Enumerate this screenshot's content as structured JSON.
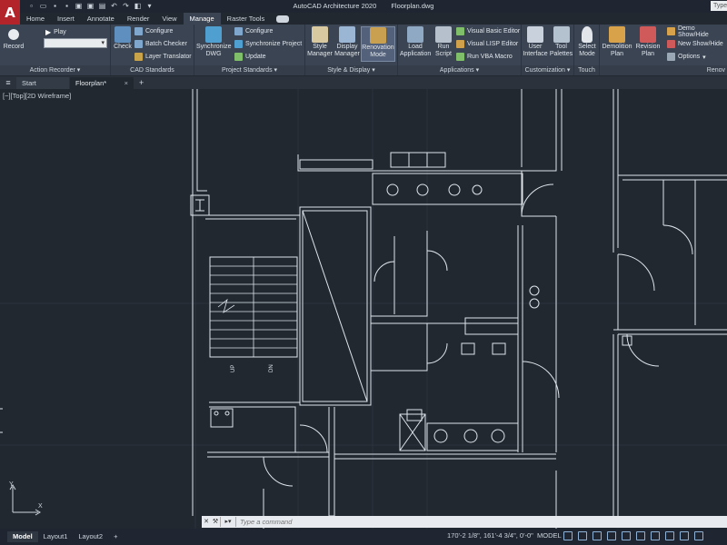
{
  "app": {
    "logo_letter": "A",
    "title": "AutoCAD Architecture 2020",
    "file": "Floorplan.dwg",
    "search_placeholder": "Type"
  },
  "ribbon_tabs": [
    "Home",
    "Insert",
    "Annotate",
    "Render",
    "View",
    "Manage",
    "Raster Tools"
  ],
  "active_tab": "Manage",
  "panels": {
    "action_recorder": {
      "title": "Action Recorder",
      "record": "Record",
      "play": "Play"
    },
    "cad_standards": {
      "title": "CAD Standards",
      "check": "Check",
      "configure": "Configure",
      "batch_checker": "Batch Checker",
      "layer_translator": "Layer Translator"
    },
    "project_standards": {
      "title": "Project Standards",
      "sync_dwg": "Synchronize DWG",
      "configure": "Configure",
      "sync_project": "Synchronize Project",
      "update": "Update"
    },
    "style_display": {
      "title": "Style & Display",
      "style_manager": "Style Manager",
      "display_manager": "Display Manager",
      "renovation_mode": "Renovation Mode"
    },
    "applications": {
      "title": "Applications",
      "load_application": "Load Application",
      "run_script": "Run Script",
      "vb_editor": "Visual Basic Editor",
      "lisp_editor": "Visual LISP Editor",
      "run_vba": "Run VBA Macro"
    },
    "customization": {
      "title": "Customization",
      "user_interface": "User Interface",
      "tool_palettes": "Tool Palettes"
    },
    "touch": {
      "title": "Touch",
      "select_mode": "Select Mode"
    },
    "renovation": {
      "title": "Renov",
      "demolition_plan": "Demolition Plan",
      "revision_plan": "Revision Plan",
      "demo_show_hide": "Demo Show/Hide",
      "new_show_hide": "New Show/Hide",
      "options": "Options"
    }
  },
  "doc_tabs": {
    "start": "Start",
    "floorplan": "Floorplan*",
    "close": "×",
    "new": "+"
  },
  "viewport_label": "[−][Top][2D Wireframe]",
  "ucs": {
    "x": "X",
    "y": "Y"
  },
  "command": {
    "placeholder": "Type a command"
  },
  "status": {
    "layouts": [
      "Model",
      "Layout1",
      "Layout2"
    ],
    "add_layout": "+",
    "coordinates": "170'-2 1/8\", 161'-4 3/4\", 0'-0\"",
    "space": "MODEL"
  }
}
